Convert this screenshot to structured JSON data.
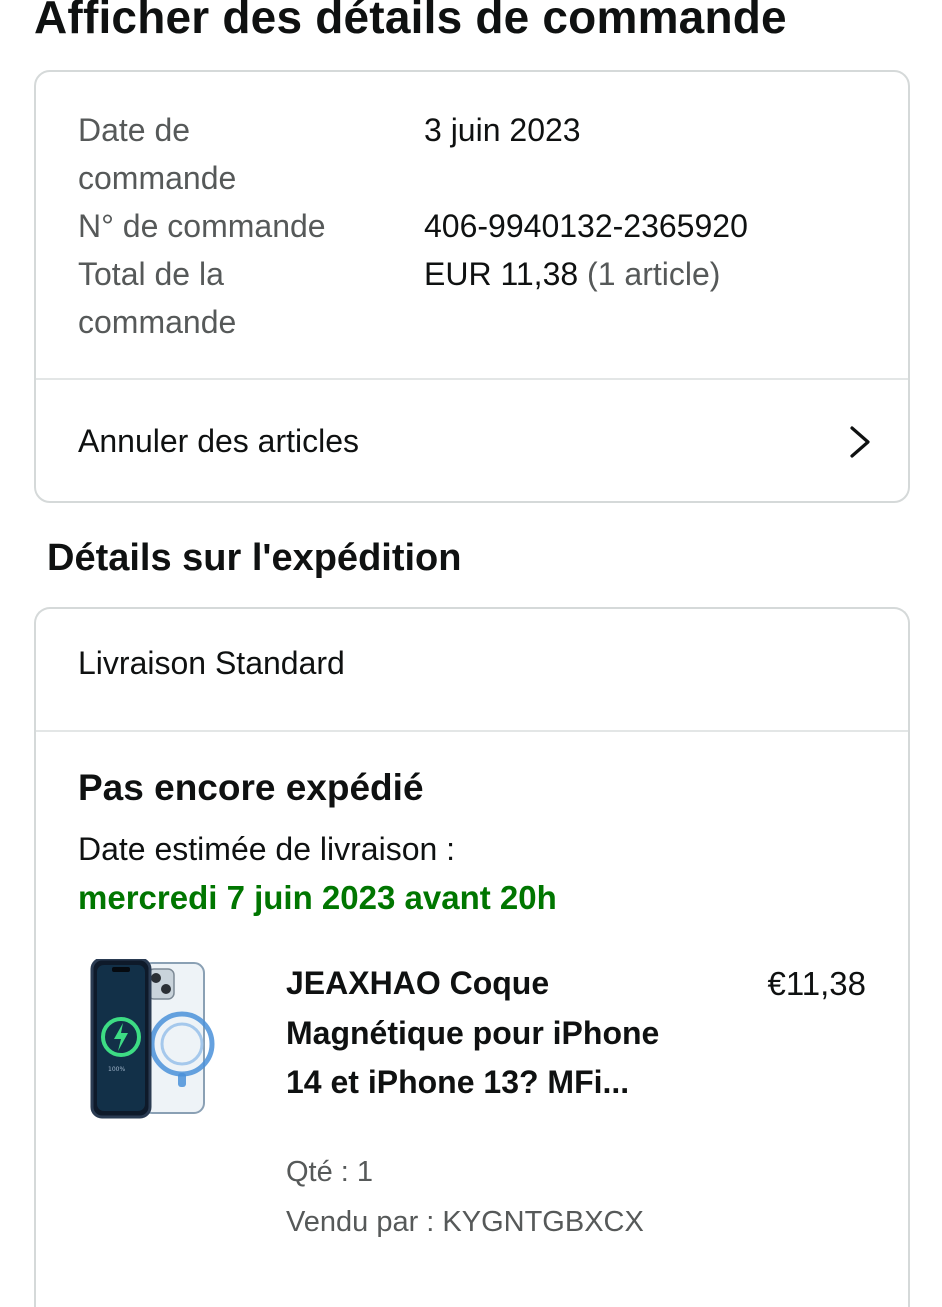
{
  "page": {
    "title": "Afficher des détails de commande"
  },
  "order": {
    "date_label": "Date de commande",
    "date_value": "3 juin 2023",
    "number_label": "N° de commande",
    "number_value": "406-9940132-2365920",
    "total_label": "Total de la commande",
    "total_value": "EUR 11,38",
    "total_items": "(1 article)",
    "cancel_label": "Annuler des articles",
    "cancel_icon": "chevron-right-icon"
  },
  "shipping": {
    "section_title": "Détails sur l'expédition",
    "method": "Livraison Standard",
    "status": "Pas encore expédié",
    "estimated_label": "Date estimée de livraison :",
    "estimated_date": "mercredi 7 juin 2023 avant 20h",
    "estimated_color": "#007600"
  },
  "product": {
    "title": "JEAXHAO Coque Magnétique pour iPhone 14 et iPhone 13? MFi...",
    "price": "€11,38",
    "qty": "Qté : 1",
    "seller": "Vendu par : KYGNTGBXCX",
    "image_icon": "phone-case-product-image"
  }
}
